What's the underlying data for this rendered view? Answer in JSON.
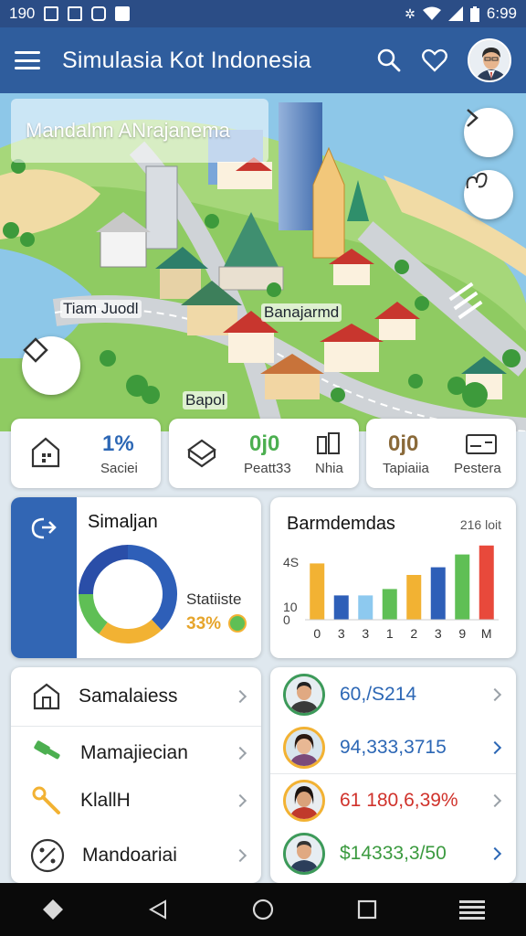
{
  "status_bar": {
    "time_left": "190",
    "time_right": "6:99"
  },
  "app_bar": {
    "title": "Simulasia Kot Indonesia"
  },
  "map": {
    "banner_text": "Mandalnn ANrajanema",
    "labels": [
      "Tiam Juodl",
      "Banajarmd",
      "Bapol"
    ]
  },
  "stats": [
    {
      "value": "1%",
      "label": "Saciei",
      "icon": "house-icon",
      "color": "#2c67b5"
    },
    {
      "value": "0j0",
      "label": "Peatt33",
      "icon": "box-icon",
      "color": "#4caf50"
    },
    {
      "value": "",
      "label": "Nhia",
      "icon": "building-icon",
      "color": "#333333"
    },
    {
      "value": "0j0",
      "label": "Tapiaiia",
      "icon": "",
      "color": "#8a6a3a"
    },
    {
      "value": "",
      "label": "Pestera",
      "icon": "chart-card-icon",
      "color": "#333333"
    }
  ],
  "donut_card": {
    "title": "Simaljan",
    "stat_label": "Statiiste",
    "stat_value": "33%",
    "segments": [
      {
        "value": 38,
        "color": "#2e5fb8"
      },
      {
        "value": 22,
        "color": "#f2b233"
      },
      {
        "value": 15,
        "color": "#5fbf55"
      },
      {
        "value": 25,
        "color": "#2a4ea8"
      }
    ]
  },
  "bar_card": {
    "title": "Barmdemdas",
    "corner_label": "216 loit",
    "chart_data": {
      "type": "bar",
      "categories": [
        "0",
        "3",
        "3",
        "1",
        "2",
        "3",
        "9",
        "M"
      ],
      "values": [
        44,
        19,
        19,
        24,
        35,
        41,
        51,
        58
      ],
      "colors": [
        "#f2b233",
        "#2e5fb8",
        "#8dc9ef",
        "#5fbf55",
        "#f2b233",
        "#2e5fb8",
        "#5fbf55",
        "#e8493b"
      ],
      "yticks": [
        "0",
        "10",
        "4S"
      ],
      "ylim": [
        0,
        60
      ]
    }
  },
  "menu_list": [
    {
      "label": "Samalaiess",
      "icon": "building-icon"
    },
    {
      "label": "Mamajiecian",
      "icon": "hammer-icon"
    },
    {
      "label": "KlallH",
      "icon": "wrench-icon"
    },
    {
      "label": "Mandoariai",
      "icon": "percent-icon"
    }
  ],
  "people_list": [
    {
      "amount": "60,/S214",
      "color": "#2c67b5",
      "chevron": "grey"
    },
    {
      "amount": "94,333,3715",
      "color": "#2c67b5",
      "chevron": "blue"
    },
    {
      "amount": "61 180,6,39%",
      "color": "#d0322b",
      "chevron": "grey"
    },
    {
      "amount": "$14333,3/50",
      "color": "#3b9a3f",
      "chevron": "blue"
    }
  ]
}
